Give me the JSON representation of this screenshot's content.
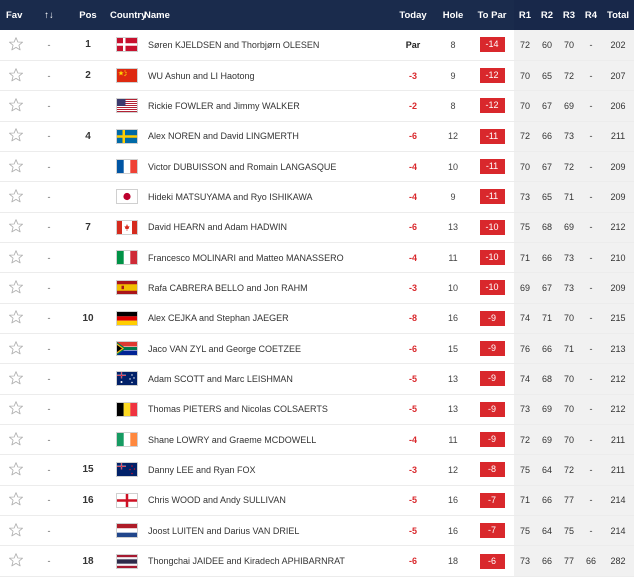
{
  "header": {
    "fav": "Fav",
    "sort_arrows": "↑↓",
    "pos": "Pos",
    "country": "Country",
    "name": "Name",
    "today": "Today",
    "hole": "Hole",
    "topar": "To Par",
    "r1": "R1",
    "r2": "R2",
    "r3": "R3",
    "r4": "R4",
    "total": "Total"
  },
  "rows": [
    {
      "move": "-",
      "pos": "1",
      "flag": "denmark",
      "name": "Søren KJELDSEN and Thorbjørn OLESEN",
      "today": "Par",
      "hole": "8",
      "topar": "-14",
      "r1": "72",
      "r2": "60",
      "r3": "70",
      "r4": "-",
      "total": "202"
    },
    {
      "move": "-",
      "pos": "2",
      "flag": "china",
      "name": "WU Ashun and LI Haotong",
      "today": "-3",
      "hole": "9",
      "topar": "-12",
      "r1": "70",
      "r2": "65",
      "r3": "72",
      "r4": "-",
      "total": "207"
    },
    {
      "move": "-",
      "pos": "",
      "flag": "usa",
      "name": "Rickie FOWLER and Jimmy WALKER",
      "today": "-2",
      "hole": "8",
      "topar": "-12",
      "r1": "70",
      "r2": "67",
      "r3": "69",
      "r4": "-",
      "total": "206"
    },
    {
      "move": "-",
      "pos": "4",
      "flag": "sweden",
      "name": "Alex NOREN and David LINGMERTH",
      "today": "-6",
      "hole": "12",
      "topar": "-11",
      "r1": "72",
      "r2": "66",
      "r3": "73",
      "r4": "-",
      "total": "211"
    },
    {
      "move": "-",
      "pos": "",
      "flag": "france",
      "name": "Victor DUBUISSON and Romain LANGASQUE",
      "today": "-4",
      "hole": "10",
      "topar": "-11",
      "r1": "70",
      "r2": "67",
      "r3": "72",
      "r4": "-",
      "total": "209"
    },
    {
      "move": "-",
      "pos": "",
      "flag": "japan",
      "name": "Hideki MATSUYAMA and Ryo ISHIKAWA",
      "today": "-4",
      "hole": "9",
      "topar": "-11",
      "r1": "73",
      "r2": "65",
      "r3": "71",
      "r4": "-",
      "total": "209"
    },
    {
      "move": "-",
      "pos": "7",
      "flag": "canada",
      "name": "David HEARN and Adam HADWIN",
      "today": "-6",
      "hole": "13",
      "topar": "-10",
      "r1": "75",
      "r2": "68",
      "r3": "69",
      "r4": "-",
      "total": "212"
    },
    {
      "move": "-",
      "pos": "",
      "flag": "italy",
      "name": "Francesco MOLINARI and Matteo MANASSERO",
      "today": "-4",
      "hole": "11",
      "topar": "-10",
      "r1": "71",
      "r2": "66",
      "r3": "73",
      "r4": "-",
      "total": "210"
    },
    {
      "move": "-",
      "pos": "",
      "flag": "spain",
      "name": "Rafa CABRERA BELLO and Jon RAHM",
      "today": "-3",
      "hole": "10",
      "topar": "-10",
      "r1": "69",
      "r2": "67",
      "r3": "73",
      "r4": "-",
      "total": "209"
    },
    {
      "move": "-",
      "pos": "10",
      "flag": "germany",
      "name": "Alex CEJKA and Stephan JAEGER",
      "today": "-8",
      "hole": "16",
      "topar": "-9",
      "r1": "74",
      "r2": "71",
      "r3": "70",
      "r4": "-",
      "total": "215"
    },
    {
      "move": "-",
      "pos": "",
      "flag": "southafrica",
      "name": "Jaco VAN ZYL and George COETZEE",
      "today": "-6",
      "hole": "15",
      "topar": "-9",
      "r1": "76",
      "r2": "66",
      "r3": "71",
      "r4": "-",
      "total": "213"
    },
    {
      "move": "-",
      "pos": "",
      "flag": "australia",
      "name": "Adam SCOTT and Marc LEISHMAN",
      "today": "-5",
      "hole": "13",
      "topar": "-9",
      "r1": "74",
      "r2": "68",
      "r3": "70",
      "r4": "-",
      "total": "212"
    },
    {
      "move": "-",
      "pos": "",
      "flag": "belgium",
      "name": "Thomas PIETERS and Nicolas COLSAERTS",
      "today": "-5",
      "hole": "13",
      "topar": "-9",
      "r1": "73",
      "r2": "69",
      "r3": "70",
      "r4": "-",
      "total": "212"
    },
    {
      "move": "-",
      "pos": "",
      "flag": "ireland",
      "name": "Shane LOWRY and Graeme MCDOWELL",
      "today": "-4",
      "hole": "11",
      "topar": "-9",
      "r1": "72",
      "r2": "69",
      "r3": "70",
      "r4": "-",
      "total": "211"
    },
    {
      "move": "-",
      "pos": "15",
      "flag": "newzealand",
      "name": "Danny LEE and Ryan FOX",
      "today": "-3",
      "hole": "12",
      "topar": "-8",
      "r1": "75",
      "r2": "64",
      "r3": "72",
      "r4": "-",
      "total": "211"
    },
    {
      "move": "-",
      "pos": "16",
      "flag": "england",
      "name": "Chris WOOD and Andy SULLIVAN",
      "today": "-5",
      "hole": "16",
      "topar": "-7",
      "r1": "71",
      "r2": "66",
      "r3": "77",
      "r4": "-",
      "total": "214"
    },
    {
      "move": "-",
      "pos": "",
      "flag": "netherlands",
      "name": "Joost LUITEN and Darius VAN DRIEL",
      "today": "-5",
      "hole": "16",
      "topar": "-7",
      "r1": "75",
      "r2": "64",
      "r3": "75",
      "r4": "-",
      "total": "214"
    },
    {
      "move": "-",
      "pos": "18",
      "flag": "thailand",
      "name": "Thongchai JAIDEE and Kiradech APHIBARNRAT",
      "today": "-6",
      "hole": "18",
      "topar": "-6",
      "r1": "73",
      "r2": "66",
      "r3": "77",
      "r4": "66",
      "total": "282"
    }
  ],
  "colors": {
    "header_bg": "#1a2b4c",
    "topar_bg": "#d9282c",
    "negative_text": "#d9282c",
    "round_col_bg": "#f1f1f1"
  }
}
